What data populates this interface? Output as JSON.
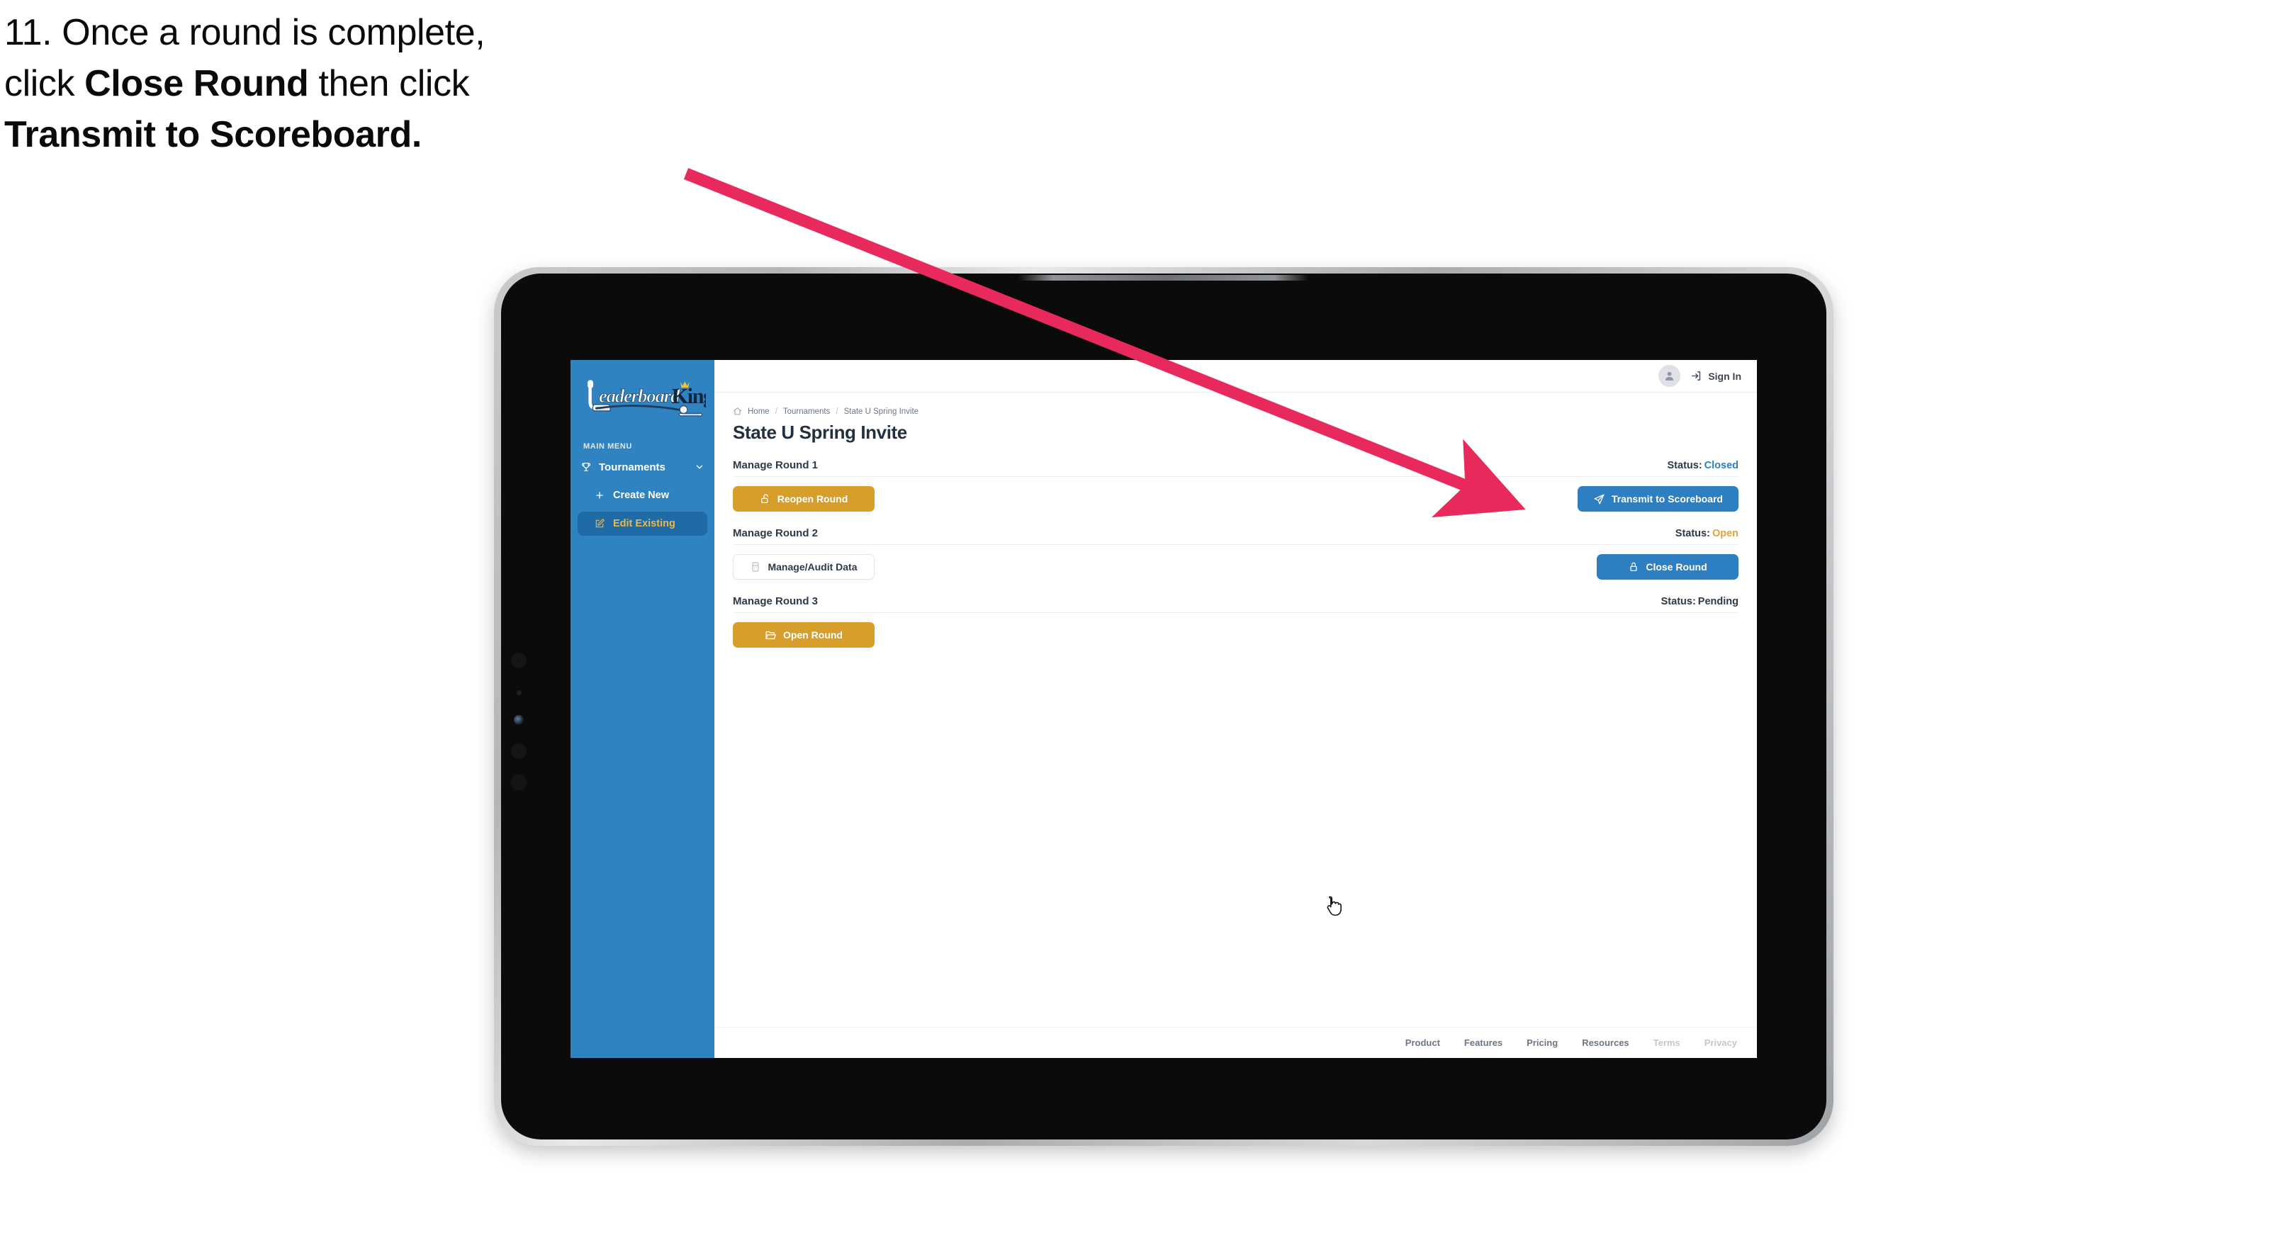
{
  "caption": {
    "line1": "11. Once a round is complete,",
    "line2_pre": "click ",
    "line2_bold": "Close Round",
    "line2_post": " then click",
    "line3_bold": "Transmit to Scoreboard."
  },
  "annotation": {
    "arrow_color": "#E8295C",
    "icon": "arrow-pointer"
  },
  "sidebar": {
    "logo_primary": "Leaderboard",
    "logo_secondary": "King",
    "menu_label": "MAIN MENU",
    "group": {
      "label": "Tournaments",
      "icon": "trophy-icon",
      "chevron": "chevron-down-icon"
    },
    "items": [
      {
        "label": "Create New",
        "icon": "plus-icon",
        "active": false
      },
      {
        "label": "Edit Existing",
        "icon": "edit-square-icon",
        "active": true
      }
    ],
    "bg_color": "#3083C1",
    "active_bg": "#1F6BA5",
    "active_text": "#E8B94A"
  },
  "topbar": {
    "avatar_icon": "user-avatar-icon",
    "signin_icon": "sign-in-arrow-icon",
    "signin_label": "Sign In"
  },
  "breadcrumb": {
    "home_icon": "home-icon",
    "items": [
      "Home",
      "Tournaments",
      "State U Spring Invite"
    ],
    "separator": "/"
  },
  "page": {
    "title": "State U Spring Invite"
  },
  "rounds": [
    {
      "name": "Manage Round 1",
      "status_label": "Status:",
      "status_value": "Closed",
      "status_kind": "closed",
      "left_button": {
        "label": "Reopen Round",
        "icon": "unlock-icon",
        "style": "gold"
      },
      "right_button": {
        "label": "Transmit to Scoreboard",
        "icon": "paper-plane-icon",
        "style": "blue"
      }
    },
    {
      "name": "Manage Round 2",
      "status_label": "Status:",
      "status_value": "Open",
      "status_kind": "open",
      "left_button": {
        "label": "Manage/Audit Data",
        "icon": "table-grid-icon",
        "style": "ghost"
      },
      "right_button": {
        "label": "Close Round",
        "icon": "lock-icon",
        "style": "blue"
      }
    },
    {
      "name": "Manage Round 3",
      "status_label": "Status:",
      "status_value": "Pending",
      "status_kind": "pending",
      "left_button": {
        "label": "Open Round",
        "icon": "folder-open-icon",
        "style": "gold"
      },
      "right_button": null
    }
  ],
  "footer": {
    "links": [
      {
        "label": "Product",
        "dim": false
      },
      {
        "label": "Features",
        "dim": false
      },
      {
        "label": "Pricing",
        "dim": false
      },
      {
        "label": "Resources",
        "dim": false
      },
      {
        "label": "Terms",
        "dim": true
      },
      {
        "label": "Privacy",
        "dim": true
      }
    ]
  },
  "colors": {
    "brand_blue": "#3083C1",
    "accent_gold": "#D79E2B",
    "button_blue": "#2D7FC1",
    "status_open": "#E0A43A",
    "status_closed": "#2D7FC1",
    "text_dark": "#2C3A4B"
  }
}
